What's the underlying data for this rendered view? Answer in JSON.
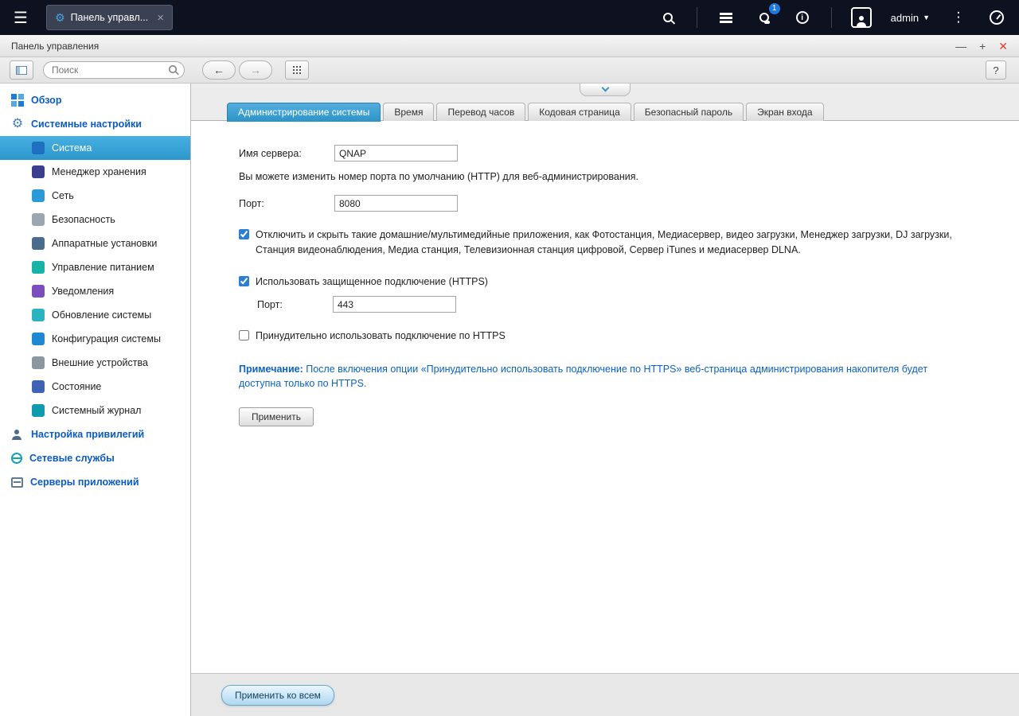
{
  "topbar": {
    "app_tab_label": "Панель управл...",
    "user_label": "admin",
    "notification_count": "1"
  },
  "window": {
    "title": "Панель управления"
  },
  "toolbar": {
    "search_placeholder": "Поиск"
  },
  "icons": {
    "hamburger": "☰",
    "gear": "⚙",
    "tab_close": "×",
    "caret": "▼",
    "overflow_menu": "⋮",
    "minimize": "—",
    "maximize": "+",
    "close": "✕",
    "back": "←",
    "forward": "→",
    "help": "?"
  },
  "sidebar": {
    "items": [
      {
        "label": "Обзор"
      },
      {
        "label": "Системные настройки"
      },
      {
        "label": "Система"
      },
      {
        "label": "Менеджер хранения"
      },
      {
        "label": "Сеть"
      },
      {
        "label": "Безопасность"
      },
      {
        "label": "Аппаратные установки"
      },
      {
        "label": "Управление питанием"
      },
      {
        "label": "Уведомления"
      },
      {
        "label": "Обновление системы"
      },
      {
        "label": "Конфигурация системы"
      },
      {
        "label": "Внешние устройства"
      },
      {
        "label": "Состояние"
      },
      {
        "label": "Системный журнал"
      },
      {
        "label": "Настройка привилегий"
      },
      {
        "label": "Сетевые службы"
      },
      {
        "label": "Серверы приложений"
      }
    ]
  },
  "tabs": [
    {
      "label": "Администрирование системы"
    },
    {
      "label": "Время"
    },
    {
      "label": "Перевод часов"
    },
    {
      "label": "Кодовая страница"
    },
    {
      "label": "Безопасный пароль"
    },
    {
      "label": "Экран входа"
    }
  ],
  "form": {
    "server_name_label": "Имя сервера:",
    "server_name_value": "QNAP",
    "port_hint": "Вы можете изменить номер порта по умолчанию (HTTP) для веб-администрирования.",
    "port_label": "Порт:",
    "port_value": "8080",
    "hide_apps_checkbox": "Отключить и скрыть такие домашние/мультимедийные приложения, как Фотостанция, Медиасервер, видео загрузки, Менеджер загрузки, DJ загрузки, Станция видеонаблюдения, Медиа станция, Телевизионная станция цифровой, Сервер iTunes и медиасервер DLNA.",
    "https_checkbox": "Использовать защищенное подключение (HTTPS)",
    "https_port_label": "Порт:",
    "https_port_value": "443",
    "force_https_checkbox": "Принудительно использовать подключение по HTTPS",
    "note_label": "Примечание:",
    "note_text": "После включения опции «Принудительно использовать подключение по HTTPS» веб-страница администрирования накопителя будет доступна только по HTTPS.",
    "apply_button": "Применить"
  },
  "footer": {
    "apply_all_button": "Применить ко всем"
  },
  "colors": {
    "accent_blue": "#31a2dc",
    "link_blue": "#0b62c4",
    "close_red": "#e23b30",
    "badge_blue": "#1f78e0"
  }
}
